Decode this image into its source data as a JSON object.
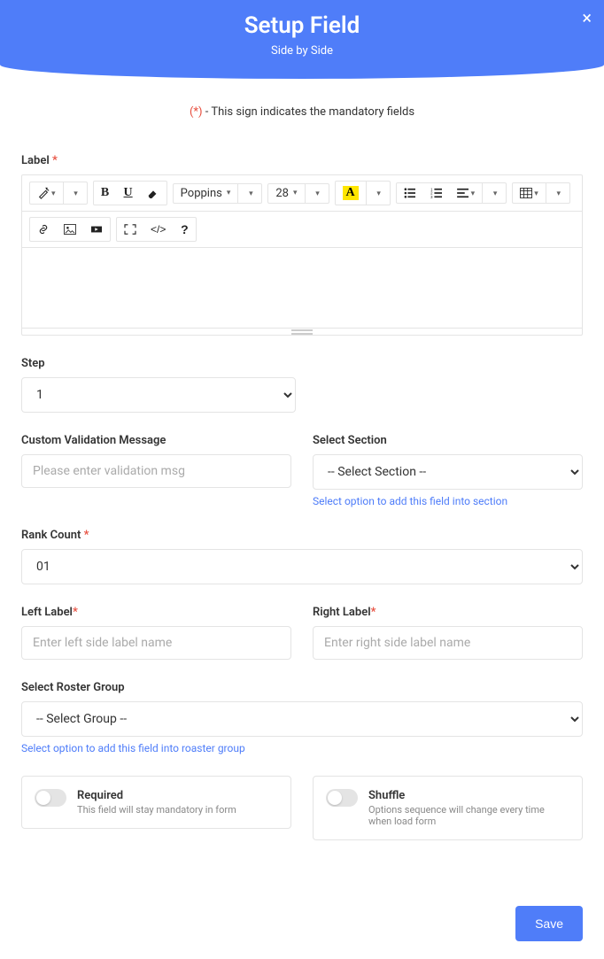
{
  "header": {
    "title": "Setup Field",
    "subtitle": "Side by Side"
  },
  "mandatory_note": {
    "star": "(*)",
    "text": " - This sign indicates the mandatory fields"
  },
  "label_section": {
    "label": "Label "
  },
  "toolbar": {
    "font_family": "Poppins",
    "font_size": "28"
  },
  "step": {
    "label": "Step",
    "value": "1"
  },
  "validation": {
    "label": "Custom Validation Message",
    "placeholder": "Please enter validation msg"
  },
  "section": {
    "label": "Select Section",
    "value": "-- Select Section --",
    "help": "Select option to add this field into section"
  },
  "rank": {
    "label": "Rank Count ",
    "value": "01"
  },
  "left_label": {
    "label": "Left Label",
    "placeholder": "Enter left side label name"
  },
  "right_label": {
    "label": "Right Label",
    "placeholder": "Enter right side label name"
  },
  "roster": {
    "label": "Select Roster Group",
    "value": "-- Select Group --",
    "help": "Select option to add this field into roaster group"
  },
  "required": {
    "title": "Required",
    "desc": "This field will stay mandatory in form"
  },
  "shuffle": {
    "title": "Shuffle",
    "desc": "Options sequence will change every time when load form"
  },
  "footer": {
    "save": "Save"
  }
}
